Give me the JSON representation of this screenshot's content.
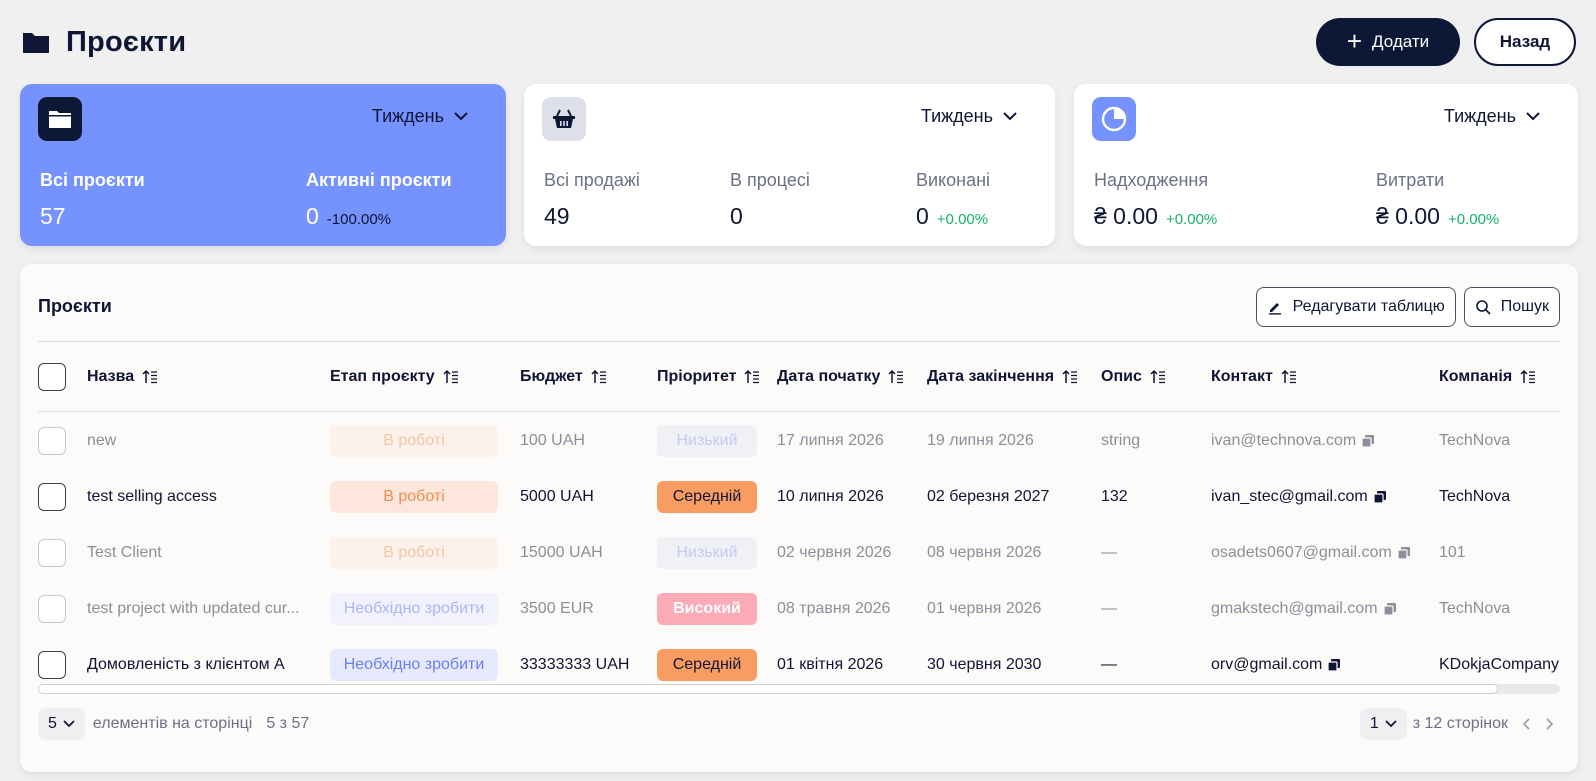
{
  "header": {
    "title": "Проєкти",
    "add_label": "Додати",
    "back_label": "Назад"
  },
  "cards": {
    "projects": {
      "period": "Тиждень",
      "all_label": "Всі проєкти",
      "all_value": "57",
      "active_label": "Активні проєкти",
      "active_value": "0",
      "active_delta": "-100.00%"
    },
    "sales": {
      "period": "Тиждень",
      "all_label": "Всі продажі",
      "all_value": "49",
      "inprogress_label": "В процесі",
      "inprogress_value": "0",
      "done_label": "Виконані",
      "done_value": "0",
      "done_delta": "+0.00%"
    },
    "finance": {
      "period": "Тиждень",
      "income_label": "Надходження",
      "income_value": "₴ 0.00",
      "income_delta": "+0.00%",
      "expense_label": "Витрати",
      "expense_value": "₴ 0.00",
      "expense_delta": "+0.00%"
    }
  },
  "table_panel": {
    "title": "Проєкти",
    "edit_label": "Редагувати таблицю",
    "search_label": "Пошук",
    "columns": {
      "name": "Назва",
      "stage": "Етап проєкту",
      "budget": "Бюджет",
      "priority": "Пріоритет",
      "start": "Дата початку",
      "end": "Дата закінчення",
      "desc": "Опис",
      "contact": "Контакт",
      "company": "Компанія"
    },
    "rows": [
      {
        "name": "new",
        "stage": "В роботі",
        "budget": "100 UAH",
        "priority": "Низький",
        "start": "17 липня 2026",
        "end": "19 липня 2026",
        "desc": "string",
        "contact": "ivan@technova.com",
        "company": "TechNova"
      },
      {
        "name": "test selling access",
        "stage": "В роботі",
        "budget": "5000 UAH",
        "priority": "Середній",
        "start": "10 липня 2026",
        "end": "02 березня 2027",
        "desc": "132",
        "contact": "ivan_stec@gmail.com",
        "company": "TechNova"
      },
      {
        "name": "Test Client",
        "stage": "В роботі",
        "budget": "15000 UAH",
        "priority": "Низький",
        "start": "02 червня 2026",
        "end": "08 червня 2026",
        "desc": "—",
        "contact": "osadets0607@gmail.com",
        "company": "101"
      },
      {
        "name": "test project with updated cur...",
        "stage": "Необхідно зробити",
        "budget": "3500 EUR",
        "priority": "Високий",
        "start": "08 травня 2026",
        "end": "01 червня 2026",
        "desc": "—",
        "contact": "gmakstech@gmail.com",
        "company": "TechNova"
      },
      {
        "name": "Домовленість з клієнтом А",
        "stage": "Необхідно зробити",
        "budget": "33333333 UAH",
        "priority": "Середній",
        "start": "01 квітня 2026",
        "end": "30 червня 2030",
        "desc": "—",
        "contact": "orv@gmail.com",
        "company": "KDokjaCompany"
      }
    ],
    "footer": {
      "per_page": "5",
      "per_page_label": "елементів на сторінці",
      "range": "5 з 57",
      "page": "1",
      "pages_label": "з 12 сторінок"
    }
  },
  "colors": {
    "accent": "#7592ff",
    "dark": "#0d1736",
    "positive": "#19b36b"
  }
}
